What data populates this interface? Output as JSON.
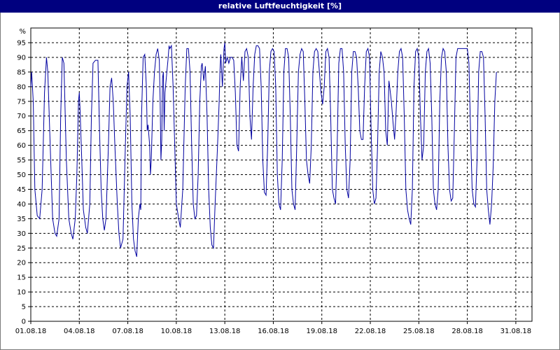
{
  "window": {
    "title": "relative Luftfeuchtigkeit [%]"
  },
  "colors": {
    "titlebar": "#00007f",
    "line": "#0000a0",
    "grid": "#000000"
  },
  "chart_data": {
    "type": "line",
    "title": "relative Luftfeuchtigkeit [%]",
    "ylabel": "%",
    "xlabel": "",
    "ylim": [
      0,
      95
    ],
    "yticks": [
      0,
      5,
      10,
      15,
      20,
      25,
      30,
      35,
      40,
      45,
      50,
      55,
      60,
      65,
      70,
      75,
      80,
      85,
      90,
      95
    ],
    "xlim": [
      0,
      31
    ],
    "xticks": [
      {
        "x": 0,
        "label": "01.08.18"
      },
      {
        "x": 3,
        "label": "04.08.18"
      },
      {
        "x": 6,
        "label": "07.08.18"
      },
      {
        "x": 9,
        "label": "10.08.18"
      },
      {
        "x": 12,
        "label": "13.08.18"
      },
      {
        "x": 15,
        "label": "16.08.18"
      },
      {
        "x": 18,
        "label": "19.08.18"
      },
      {
        "x": 21,
        "label": "22.08.18"
      },
      {
        "x": 24,
        "label": "25.08.18"
      },
      {
        "x": 27,
        "label": "28.08.18"
      },
      {
        "x": 30,
        "label": "31.08.18"
      }
    ],
    "grid": true,
    "series": [
      {
        "points": [
          [
            0.0,
            80
          ],
          [
            0.05,
            85
          ],
          [
            0.15,
            75
          ],
          [
            0.25,
            45
          ],
          [
            0.4,
            36
          ],
          [
            0.55,
            35
          ],
          [
            0.7,
            45
          ],
          [
            0.85,
            78
          ],
          [
            0.97,
            90
          ],
          [
            1.05,
            85
          ],
          [
            1.2,
            60
          ],
          [
            1.35,
            35
          ],
          [
            1.5,
            30
          ],
          [
            1.6,
            29
          ],
          [
            1.75,
            35
          ],
          [
            1.85,
            70
          ],
          [
            1.95,
            90
          ],
          [
            2.05,
            88
          ],
          [
            2.2,
            55
          ],
          [
            2.35,
            35
          ],
          [
            2.5,
            30
          ],
          [
            2.6,
            28
          ],
          [
            2.75,
            35
          ],
          [
            2.85,
            50
          ],
          [
            2.95,
            75
          ],
          [
            3.0,
            78
          ],
          [
            3.05,
            72
          ],
          [
            3.15,
            55
          ],
          [
            3.25,
            38
          ],
          [
            3.4,
            32
          ],
          [
            3.5,
            30
          ],
          [
            3.65,
            40
          ],
          [
            3.75,
            70
          ],
          [
            3.85,
            88
          ],
          [
            4.0,
            89
          ],
          [
            4.15,
            89
          ],
          [
            4.25,
            65
          ],
          [
            4.35,
            45
          ],
          [
            4.45,
            35
          ],
          [
            4.55,
            31
          ],
          [
            4.65,
            35
          ],
          [
            4.8,
            60
          ],
          [
            4.9,
            80
          ],
          [
            5.0,
            83
          ],
          [
            5.1,
            75
          ],
          [
            5.2,
            60
          ],
          [
            5.35,
            40
          ],
          [
            5.45,
            30
          ],
          [
            5.55,
            25
          ],
          [
            5.7,
            28
          ],
          [
            5.85,
            60
          ],
          [
            5.95,
            80
          ],
          [
            6.05,
            85
          ],
          [
            6.15,
            70
          ],
          [
            6.25,
            40
          ],
          [
            6.35,
            28
          ],
          [
            6.45,
            24
          ],
          [
            6.55,
            22
          ],
          [
            6.65,
            35
          ],
          [
            6.75,
            40
          ],
          [
            6.8,
            38
          ],
          [
            6.85,
            70
          ],
          [
            6.95,
            90
          ],
          [
            7.05,
            91
          ],
          [
            7.15,
            80
          ],
          [
            7.2,
            65
          ],
          [
            7.25,
            67
          ],
          [
            7.35,
            60
          ],
          [
            7.4,
            50
          ],
          [
            7.45,
            55
          ],
          [
            7.55,
            75
          ],
          [
            7.65,
            85
          ],
          [
            7.75,
            91
          ],
          [
            7.85,
            93
          ],
          [
            7.95,
            89
          ],
          [
            8.0,
            75
          ],
          [
            8.05,
            55
          ],
          [
            8.1,
            62
          ],
          [
            8.15,
            83
          ],
          [
            8.2,
            85
          ],
          [
            8.25,
            65
          ],
          [
            8.3,
            78
          ],
          [
            8.4,
            84
          ],
          [
            8.5,
            90
          ],
          [
            8.55,
            94
          ],
          [
            8.6,
            93
          ],
          [
            8.7,
            94
          ],
          [
            8.8,
            80
          ],
          [
            8.9,
            60
          ],
          [
            9.0,
            40
          ],
          [
            9.15,
            35
          ],
          [
            9.25,
            32
          ],
          [
            9.4,
            45
          ],
          [
            9.55,
            80
          ],
          [
            9.65,
            93
          ],
          [
            9.75,
            93
          ],
          [
            9.85,
            85
          ],
          [
            9.95,
            60
          ],
          [
            10.05,
            40
          ],
          [
            10.15,
            35
          ],
          [
            10.25,
            36
          ],
          [
            10.35,
            50
          ],
          [
            10.45,
            75
          ],
          [
            10.55,
            87
          ],
          [
            10.6,
            88
          ],
          [
            10.7,
            82
          ],
          [
            10.8,
            87
          ],
          [
            10.9,
            70
          ],
          [
            11.0,
            45
          ],
          [
            11.1,
            32
          ],
          [
            11.2,
            26
          ],
          [
            11.3,
            25
          ],
          [
            11.4,
            40
          ],
          [
            11.55,
            60
          ],
          [
            11.65,
            75
          ],
          [
            11.7,
            85
          ],
          [
            11.75,
            91
          ],
          [
            11.85,
            80
          ],
          [
            11.95,
            93
          ],
          [
            12.0,
            95
          ],
          [
            12.05,
            88
          ],
          [
            12.15,
            90
          ],
          [
            12.25,
            88
          ],
          [
            12.35,
            90
          ],
          [
            12.45,
            90
          ],
          [
            12.55,
            89
          ],
          [
            12.65,
            78
          ],
          [
            12.75,
            60
          ],
          [
            12.85,
            58
          ],
          [
            12.95,
            80
          ],
          [
            13.05,
            90
          ],
          [
            13.15,
            82
          ],
          [
            13.25,
            92
          ],
          [
            13.35,
            93
          ],
          [
            13.45,
            90
          ],
          [
            13.55,
            70
          ],
          [
            13.65,
            62
          ],
          [
            13.75,
            80
          ],
          [
            13.85,
            91
          ],
          [
            13.95,
            94
          ],
          [
            14.05,
            94
          ],
          [
            14.15,
            93
          ],
          [
            14.25,
            80
          ],
          [
            14.35,
            55
          ],
          [
            14.45,
            44
          ],
          [
            14.55,
            43
          ],
          [
            14.65,
            60
          ],
          [
            14.75,
            85
          ],
          [
            14.85,
            92
          ],
          [
            14.95,
            93
          ],
          [
            15.05,
            92
          ],
          [
            15.15,
            80
          ],
          [
            15.25,
            50
          ],
          [
            15.35,
            40
          ],
          [
            15.45,
            38
          ],
          [
            15.55,
            55
          ],
          [
            15.65,
            85
          ],
          [
            15.75,
            93
          ],
          [
            15.85,
            93
          ],
          [
            15.95,
            90
          ],
          [
            16.05,
            70
          ],
          [
            16.15,
            45
          ],
          [
            16.25,
            40
          ],
          [
            16.35,
            38
          ],
          [
            16.45,
            60
          ],
          [
            16.55,
            85
          ],
          [
            16.65,
            91
          ],
          [
            16.75,
            93
          ],
          [
            16.85,
            92
          ],
          [
            16.95,
            75
          ],
          [
            17.05,
            55
          ],
          [
            17.15,
            50
          ],
          [
            17.25,
            47
          ],
          [
            17.35,
            60
          ],
          [
            17.45,
            85
          ],
          [
            17.55,
            92
          ],
          [
            17.65,
            93
          ],
          [
            17.75,
            92
          ],
          [
            17.85,
            85
          ],
          [
            17.95,
            78
          ],
          [
            18.05,
            74
          ],
          [
            18.15,
            80
          ],
          [
            18.25,
            92
          ],
          [
            18.35,
            93
          ],
          [
            18.45,
            90
          ],
          [
            18.55,
            70
          ],
          [
            18.65,
            45
          ],
          [
            18.75,
            42
          ],
          [
            18.85,
            40
          ],
          [
            18.95,
            60
          ],
          [
            19.05,
            88
          ],
          [
            19.15,
            93
          ],
          [
            19.25,
            93
          ],
          [
            19.35,
            85
          ],
          [
            19.45,
            60
          ],
          [
            19.55,
            45
          ],
          [
            19.65,
            42
          ],
          [
            19.75,
            55
          ],
          [
            19.85,
            85
          ],
          [
            19.95,
            92
          ],
          [
            20.05,
            92
          ],
          [
            20.15,
            90
          ],
          [
            20.25,
            80
          ],
          [
            20.35,
            65
          ],
          [
            20.45,
            62
          ],
          [
            20.55,
            62
          ],
          [
            20.65,
            80
          ],
          [
            20.75,
            92
          ],
          [
            20.85,
            93
          ],
          [
            20.95,
            90
          ],
          [
            21.05,
            65
          ],
          [
            21.15,
            45
          ],
          [
            21.25,
            40
          ],
          [
            21.35,
            42
          ],
          [
            21.45,
            60
          ],
          [
            21.55,
            85
          ],
          [
            21.65,
            92
          ],
          [
            21.75,
            90
          ],
          [
            21.85,
            85
          ],
          [
            21.95,
            65
          ],
          [
            22.05,
            60
          ],
          [
            22.15,
            82
          ],
          [
            22.2,
            80
          ],
          [
            22.3,
            75
          ],
          [
            22.4,
            68
          ],
          [
            22.5,
            62
          ],
          [
            22.6,
            72
          ],
          [
            22.7,
            85
          ],
          [
            22.8,
            92
          ],
          [
            22.9,
            93
          ],
          [
            23.0,
            90
          ],
          [
            23.1,
            70
          ],
          [
            23.2,
            45
          ],
          [
            23.3,
            38
          ],
          [
            23.4,
            35
          ],
          [
            23.5,
            33
          ],
          [
            23.6,
            45
          ],
          [
            23.7,
            80
          ],
          [
            23.8,
            92
          ],
          [
            23.9,
            93
          ],
          [
            24.0,
            90
          ],
          [
            24.1,
            70
          ],
          [
            24.2,
            55
          ],
          [
            24.3,
            60
          ],
          [
            24.4,
            85
          ],
          [
            24.5,
            92
          ],
          [
            24.6,
            93
          ],
          [
            24.7,
            88
          ],
          [
            24.8,
            70
          ],
          [
            24.9,
            45
          ],
          [
            25.0,
            40
          ],
          [
            25.1,
            38
          ],
          [
            25.2,
            45
          ],
          [
            25.3,
            75
          ],
          [
            25.4,
            90
          ],
          [
            25.5,
            93
          ],
          [
            25.6,
            92
          ],
          [
            25.7,
            85
          ],
          [
            25.8,
            60
          ],
          [
            25.9,
            45
          ],
          [
            26.0,
            41
          ],
          [
            26.1,
            42
          ],
          [
            26.2,
            65
          ],
          [
            26.3,
            90
          ],
          [
            26.4,
            93
          ],
          [
            26.5,
            93
          ],
          [
            26.6,
            93
          ],
          [
            26.7,
            93
          ],
          [
            26.8,
            93
          ],
          [
            26.9,
            93
          ],
          [
            27.0,
            93
          ],
          [
            27.1,
            88
          ],
          [
            27.2,
            65
          ],
          [
            27.3,
            45
          ],
          [
            27.4,
            40
          ],
          [
            27.5,
            39
          ],
          [
            27.6,
            55
          ],
          [
            27.7,
            85
          ],
          [
            27.8,
            92
          ],
          [
            27.9,
            92
          ],
          [
            28.0,
            90
          ],
          [
            28.1,
            70
          ],
          [
            28.2,
            45
          ],
          [
            28.3,
            38
          ],
          [
            28.4,
            33
          ],
          [
            28.5,
            40
          ],
          [
            28.6,
            53
          ],
          [
            28.7,
            75
          ],
          [
            28.8,
            85
          ]
        ]
      }
    ]
  }
}
